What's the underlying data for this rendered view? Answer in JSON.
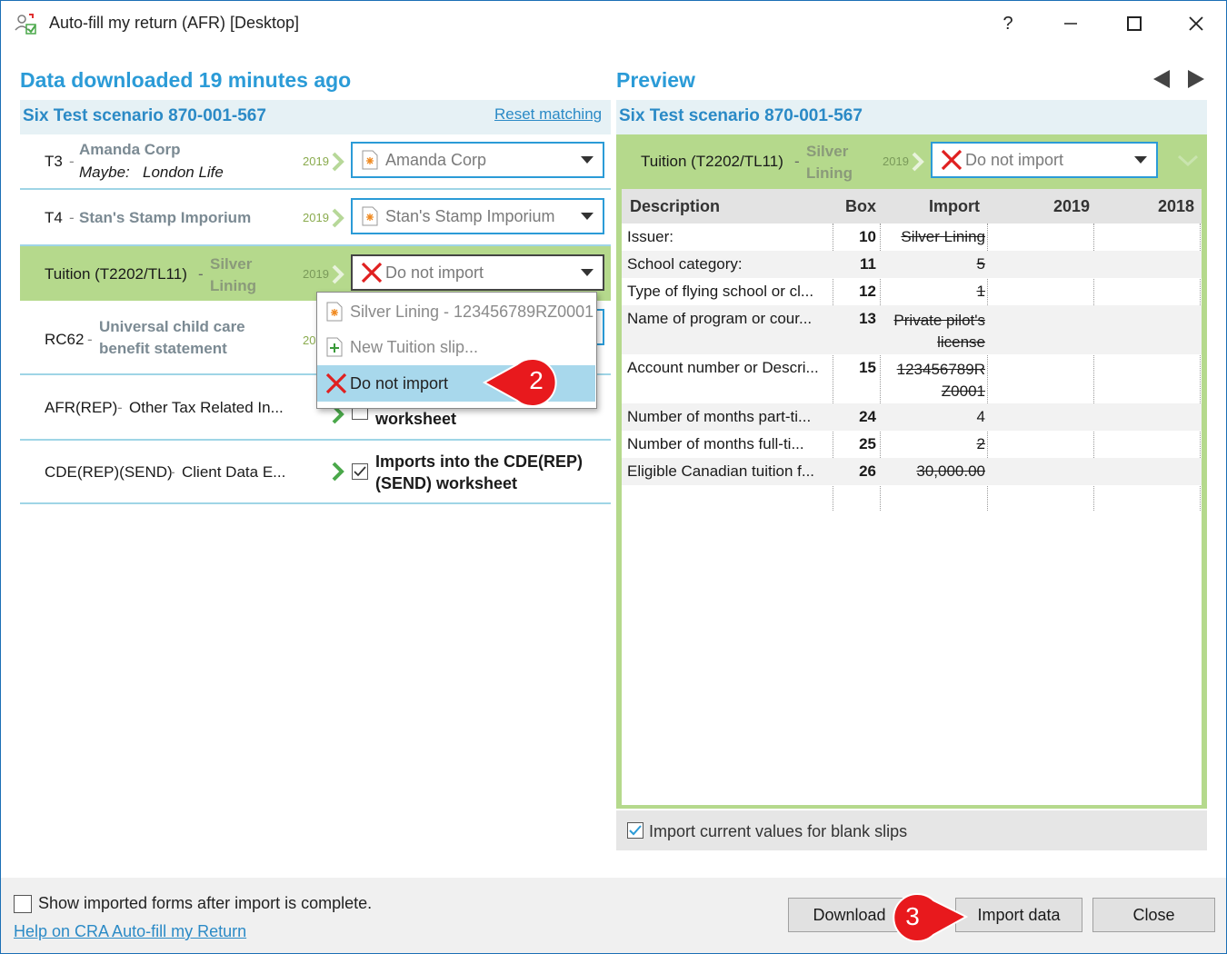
{
  "window": {
    "title": "Auto-fill my return (AFR) [Desktop]",
    "help_glyph": "?",
    "minimize_glyph": "—",
    "maximize_glyph": "☐",
    "close_glyph": "✕"
  },
  "left": {
    "heading": "Data downloaded 19 minutes ago",
    "scenario": "Six Test scenario 870-001-567",
    "reset_link": "Reset matching",
    "rows": [
      {
        "code": "T3",
        "dash": "-",
        "name": "Amanda Corp",
        "maybe_label": "Maybe:",
        "maybe_value": "London Life",
        "year": "2019",
        "combo": "Amanda Corp"
      },
      {
        "code": "T4",
        "dash": "-",
        "name": "Stan's Stamp Imporium",
        "year": "2019",
        "combo": "Stan's Stamp Imporium"
      },
      {
        "code": "Tuition (T2202/TL11)",
        "dash": "-",
        "name": "Silver Lining",
        "year": "2019",
        "combo": "Do not import"
      },
      {
        "code": "RC62",
        "dash": "-",
        "name": "Universal child care benefit statement",
        "year": "20"
      },
      {
        "code": "AFR(REP)",
        "dash": "-",
        "name": "Other Tax Related In...",
        "import_text": "worksheet"
      },
      {
        "code": "CDE(REP)(SEND)",
        "dash": "-",
        "name": "Client Data E...",
        "import_text": "Imports into the CDE(REP) (SEND) worksheet"
      }
    ],
    "dropdown": [
      {
        "label": "Silver Lining - 123456789RZ0001",
        "icon": "slip-icon"
      },
      {
        "label": "New Tuition slip...",
        "icon": "plus-icon"
      },
      {
        "label": "Do not import",
        "icon": "x-icon"
      }
    ]
  },
  "preview": {
    "heading": "Preview",
    "scenario": "Six Test scenario 870-001-567",
    "slip_code": "Tuition (T2202/TL11)",
    "slip_dash": "-",
    "slip_name": "Silver Lining",
    "slip_year": "2019",
    "combo": "Do not import",
    "columns": [
      "Description",
      "Box",
      "Import",
      "2019",
      "2018"
    ],
    "rows": [
      {
        "desc": "Issuer:",
        "box": "10",
        "import": "Silver Lining"
      },
      {
        "desc": "School category:",
        "box": "11",
        "import": "5"
      },
      {
        "desc": "Type of flying school or cl...",
        "box": "12",
        "import": "1"
      },
      {
        "desc": "Name of program or cour...",
        "box": "13",
        "import": "Private pilot's license"
      },
      {
        "desc": "Account number or Descri...",
        "box": "15",
        "import": "123456789R Z0001"
      },
      {
        "desc": "Number of months part-ti...",
        "box": "24",
        "import": "4"
      },
      {
        "desc": "Number of months full-ti...",
        "box": "25",
        "import": "2"
      },
      {
        "desc": "Eligible Canadian tuition f...",
        "box": "26",
        "import": "30,000.00"
      }
    ],
    "blank_slips_label": "Import current values for blank slips"
  },
  "footer": {
    "show_forms_label": "Show imported forms after import is complete.",
    "help_link": "Help on CRA Auto-fill my Return",
    "download_label": "Download",
    "import_label": "Import data",
    "close_label": "Close"
  },
  "callouts": {
    "step2": "2",
    "step3": "3"
  },
  "colors": {
    "accent": "#2b9bd7",
    "selected_row": "#b5d98c",
    "preview_border": "#b5d98c",
    "callout": "#e8191d"
  }
}
